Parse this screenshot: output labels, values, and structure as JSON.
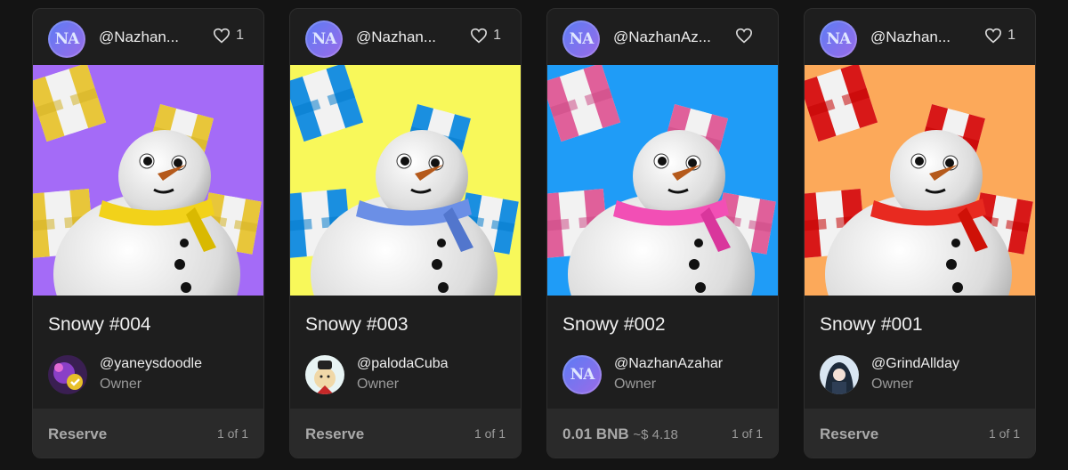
{
  "cards": [
    {
      "creator_initials": "NA",
      "creator_handle": "@Nazhan...",
      "likes": "1",
      "title": "Snowy #004",
      "owner_handle": "@yaneysdoodle",
      "owner_role": "Owner",
      "price_label": "Reserve",
      "price_usd": "",
      "edition": "1 of 1",
      "colors": {
        "bg": "#a46bf7",
        "gift": "#e8c63a",
        "scarf": "#f2d21a"
      }
    },
    {
      "creator_initials": "NA",
      "creator_handle": "@Nazhan...",
      "likes": "1",
      "title": "Snowy #003",
      "owner_handle": "@palodaCuba",
      "owner_role": "Owner",
      "price_label": "Reserve",
      "price_usd": "",
      "edition": "1 of 1",
      "colors": {
        "bg": "#f8f85a",
        "gift": "#1a8fe0",
        "scarf": "#6b8fe6"
      }
    },
    {
      "creator_initials": "NA",
      "creator_handle": "@NazhanAz...",
      "likes": "",
      "title": "Snowy #002",
      "owner_handle": "@NazhanAzahar",
      "owner_role": "Owner",
      "price_label": "0.01 BNB",
      "price_usd": "~$ 4.18",
      "edition": "1 of 1",
      "colors": {
        "bg": "#1f9cf7",
        "gift": "#e0609a",
        "scarf": "#f24fb5"
      }
    },
    {
      "creator_initials": "NA",
      "creator_handle": "@Nazhan...",
      "likes": "1",
      "title": "Snowy #001",
      "owner_handle": "@GrindAllday",
      "owner_role": "Owner",
      "price_label": "Reserve",
      "price_usd": "",
      "edition": "1 of 1",
      "colors": {
        "bg": "#fca95a",
        "gift": "#d81818",
        "scarf": "#e82a20"
      }
    }
  ]
}
